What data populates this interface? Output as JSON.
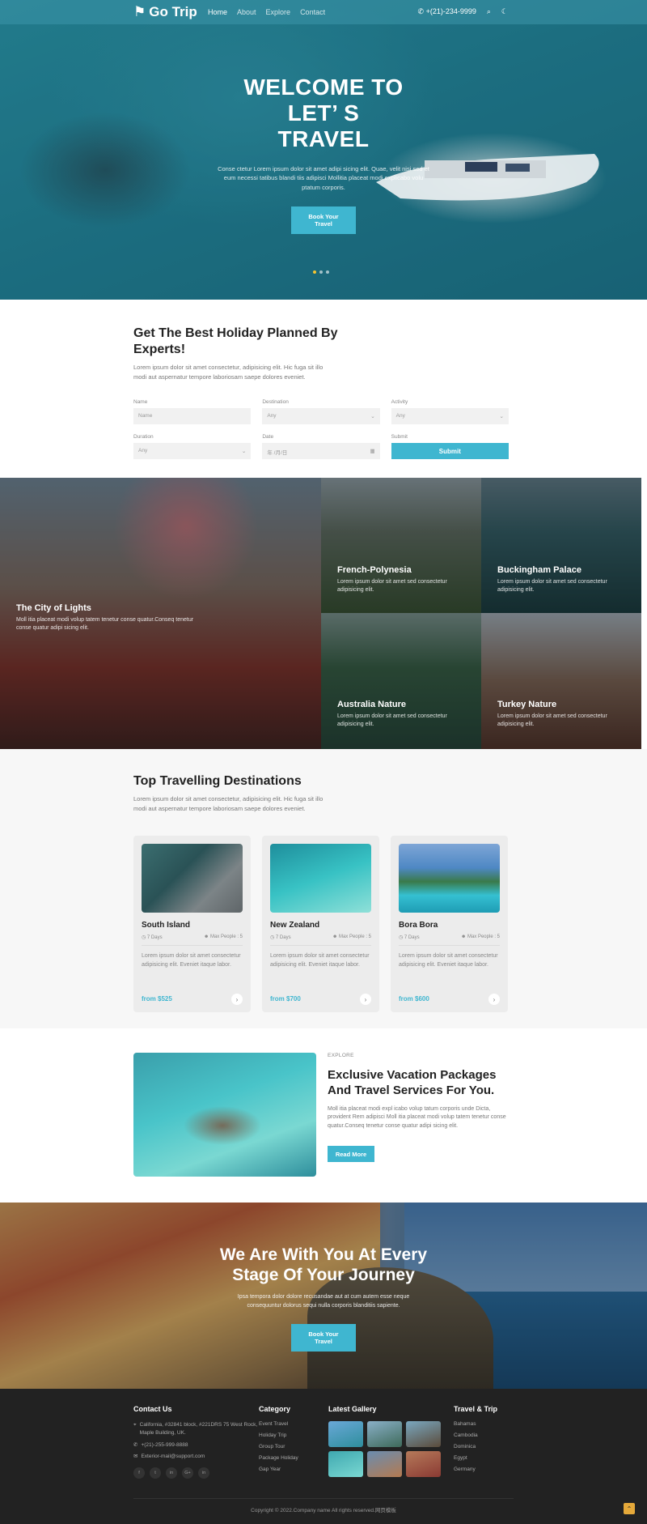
{
  "nav": {
    "logo": "Go Trip",
    "links": [
      "Home",
      "About",
      "Explore",
      "Contact"
    ],
    "phone": "+(21)-234-9999"
  },
  "hero": {
    "title": "WELCOME TO LET’ S TRAVEL",
    "text": "Conse ctetur Lorem ipsum dolor sit amet adipi sicing elit. Quae, velit nisi sed et eum necessi tatibus blandi tiis adipisci Mollitia placeat modi explicabo volu ptatum corporis.",
    "button": "Book Your Travel",
    "slides": 3
  },
  "booking": {
    "title": "Get The Best Holiday Planned By Experts!",
    "subtitle": "Lorem ipsum dolor sit amet consectetur, adipisicing elit. Hic fuga sit illo modi aut aspernatur tempore laboriosam saepe dolores eveniet.",
    "fields": [
      {
        "label": "Name",
        "value": "Name"
      },
      {
        "label": "Destination",
        "value": "Any"
      },
      {
        "label": "Activity",
        "value": "Any"
      },
      {
        "label": "Duration",
        "value": "Any"
      },
      {
        "label": "Date",
        "value": "年 /月/日"
      }
    ],
    "submit_label": "Submit",
    "submit_button": "Submit"
  },
  "tours": [
    {
      "title": "The City of Lights",
      "text": "Moll itia placeat modi volup tatem tenetur conse quatur.Conseq tenetur conse quatur adipi sicing elit."
    },
    {
      "title": "French-Polynesia",
      "text": "Lorem ipsum dolor sit amet sed consectetur adipisicing elit."
    },
    {
      "title": "Buckingham Palace",
      "text": "Lorem ipsum dolor sit amet sed consectetur adipisicing elit."
    },
    {
      "title": "Australia Nature",
      "text": "Lorem ipsum dolor sit amet sed consectetur adipisicing elit."
    },
    {
      "title": "Turkey Nature",
      "text": "Lorem ipsum dolor sit amet sed consectetur adipisicing elit."
    }
  ],
  "destinations": {
    "title": "Top Travelling Destinations",
    "subtitle": "Lorem ipsum dolor sit amet consectetur, adipisicing elit. Hic fuga sit illo modi aut aspernatur tempore laboriosam saepe dolores eveniet.",
    "cards": [
      {
        "name": "South Island",
        "days": "7 Days",
        "people": "Max People : 5",
        "text": "Lorem ipsum dolor sit amet consectetur adipisicing elit. Eveniet itaque labor.",
        "price": "from $525"
      },
      {
        "name": "New Zealand",
        "days": "7 Days",
        "people": "Max People : 5",
        "text": "Lorem ipsum dolor sit amet consectetur adipisicing elit. Eveniet itaque labor.",
        "price": "from $700"
      },
      {
        "name": "Bora Bora",
        "days": "7 Days",
        "people": "Max People : 5",
        "text": "Lorem ipsum dolor sit amet consectetur adipisicing elit. Eveniet itaque labor.",
        "price": "from $600"
      }
    ]
  },
  "exclusive": {
    "eyebrow": "EXPLORE",
    "title": "Exclusive Vacation Packages And Travel Services For You.",
    "text": "Moll itia placeat modi expl icabo volup tatum corporis unde Dicta, provident Rem adipisci Moll itia placeat modi volup tatem tenetur conse quatur.Conseq tenetur conse quatur adipi sicing elit.",
    "button": "Read More"
  },
  "journey": {
    "title": "We Are With You At Every Stage Of Your Journey",
    "text": "Ipsa tempora dolor dolore recusandae aut at cum autem esse neque consequuntur dolorus sequi nulla corporis blanditiis sapiente.",
    "button": "Book Your Travel"
  },
  "footer": {
    "contact_title": "Contact Us",
    "address": "California, #32841 block, #221DRS 75 West Rock, Maple Building, UK.",
    "phone": "+(21)-255-999-8888",
    "email": "Exterior-mail@support.com",
    "socials": [
      "f",
      "t",
      "in",
      "G+",
      "in"
    ],
    "category_title": "Category",
    "categories": [
      "Event Travel",
      "Holiday Trip",
      "Group Tour",
      "Package Holiday",
      "Gap Year"
    ],
    "gallery_title": "Latest Gallery",
    "travel_title": "Travel & Trip",
    "travel_links": [
      "Bahamas",
      "Cambodia",
      "Dominica",
      "Egypt",
      "Germany"
    ],
    "copyright": "Copyright © 2022.Company name All rights reserved.网页模板"
  }
}
